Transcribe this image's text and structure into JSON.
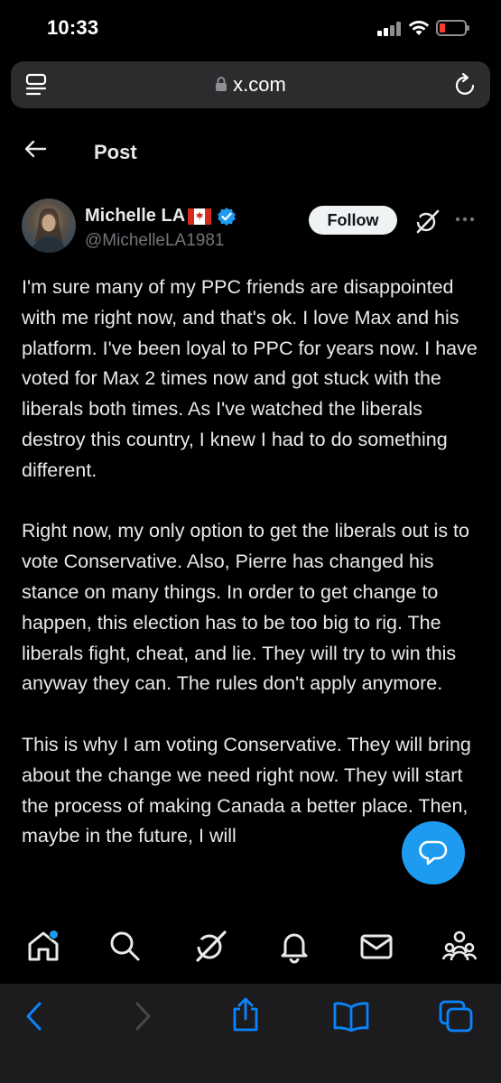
{
  "status_bar": {
    "time": "10:33",
    "battery_color": "#ff3b30"
  },
  "browser": {
    "url": "x.com",
    "icons": [
      "tab-overview-icon",
      "lock-icon",
      "reload-icon"
    ]
  },
  "header": {
    "title": "Post",
    "back_icon": "back-arrow-icon"
  },
  "post": {
    "author_name": "Michelle LA",
    "author_handle": "@MichelleLA1981",
    "follow_label": "Follow",
    "paragraphs": [
      "I'm sure many of my PPC friends are disappointed with me right now, and that's ok. I love Max and his platform. I've been loyal to PPC for years now. I have voted for Max 2 times now and got stuck with the liberals both times. As I've watched the liberals destroy this country, I knew I had to do something different.",
      "Right now, my only option to get the liberals out is to vote Conservative. Also, Pierre has changed his stance on many things. In order to get change to happen, this election has to be too big to rig. The liberals fight, cheat, and lie. They will try to win this anyway they can. The rules don't apply anymore.",
      "This is why I am voting Conservative. They will bring about the change we need right now. They will start the process of making Canada a better place. Then, maybe in the future, I will"
    ]
  },
  "bottom_nav": {
    "items": [
      "home-icon",
      "search-icon",
      "grok-icon",
      "notifications-icon",
      "messages-icon",
      "communities-icon"
    ]
  },
  "safari_toolbar": {
    "items": [
      "back-icon",
      "forward-icon",
      "share-icon",
      "bookmarks-icon",
      "tabs-icon"
    ]
  },
  "colors": {
    "background": "#000000",
    "text": "#e7e9ea",
    "secondary_text": "#71767b",
    "accent": "#1d9bf0",
    "safari_accent": "#0a84ff"
  }
}
